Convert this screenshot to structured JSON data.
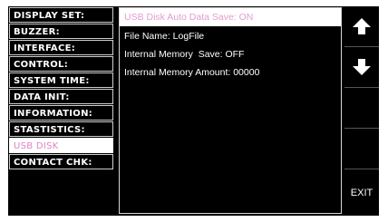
{
  "menu": {
    "items": [
      {
        "label": "DISPLAY SET:"
      },
      {
        "label": "BUZZER:"
      },
      {
        "label": "INTERFACE:"
      },
      {
        "label": "CONTROL:"
      },
      {
        "label": "SYSTEM TIME:"
      },
      {
        "label": "DATA INIT:"
      },
      {
        "label": "INFORMATION:"
      },
      {
        "label": "STASTISTICS:"
      },
      {
        "label": "USB DISK"
      },
      {
        "label": "CONTACT CHK:"
      }
    ],
    "selected_index": 8
  },
  "content": {
    "header": "USB Disk Auto Data Save: ON",
    "lines": [
      "File Name: LogFile",
      "Internal Memory  Save: OFF",
      "Internal Memory Amount: 00000"
    ]
  },
  "softkeys": {
    "up_icon": "arrow-up-icon",
    "down_icon": "arrow-down-icon",
    "exit_label": "EXIT"
  },
  "colors": {
    "background": "#000000",
    "highlight_bg": "#ffffff",
    "highlight_text": "#e082c4",
    "text": "#ffffff"
  }
}
